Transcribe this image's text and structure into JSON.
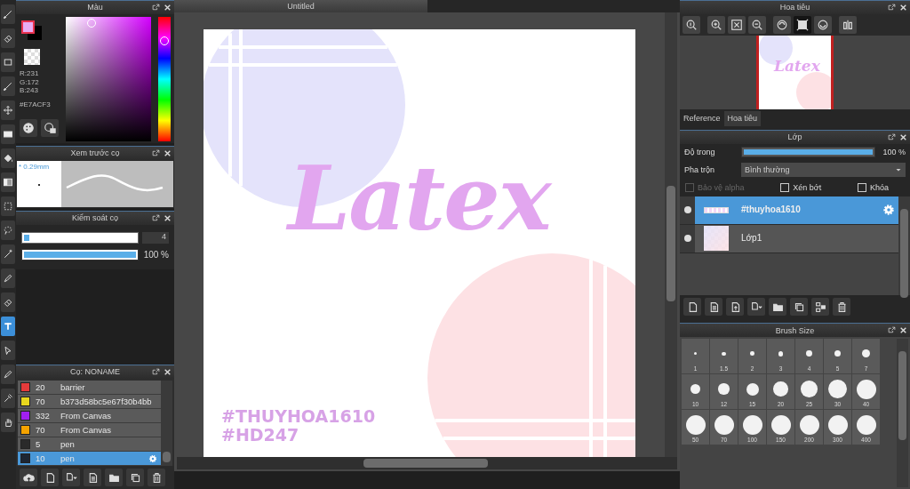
{
  "tools": [
    {
      "selected": false
    },
    {
      "selected": false
    },
    {
      "selected": false
    },
    {
      "selected": false
    },
    {
      "selected": false
    },
    {
      "selected": false
    },
    {
      "selected": false
    },
    {
      "selected": false
    },
    {
      "selected": false
    },
    {
      "selected": false
    },
    {
      "selected": false
    },
    {
      "selected": false
    },
    {
      "selected": false
    },
    {
      "selected": true
    },
    {
      "selected": false
    },
    {
      "selected": false
    },
    {
      "selected": false
    },
    {
      "selected": false
    }
  ],
  "color_panel": {
    "title": "Màu",
    "r": "R:231",
    "g": "G:172",
    "b": "B:243",
    "hex": "#E7ACF3"
  },
  "brush_preview": {
    "title": "Xem trước cọ",
    "size": "* 0.29mm"
  },
  "brush_control": {
    "title": "Kiểm soát cọ",
    "sliders": [
      {
        "kind": "boxed",
        "level": 0.05,
        "reading": "4"
      },
      {
        "kind": "plain",
        "level": 1,
        "reading": "100 %"
      }
    ]
  },
  "brush_list": {
    "title": "Cọ: NONAME",
    "brushes": [
      {
        "color": "#e53b3b",
        "size": "20",
        "name": "barrier",
        "selected": false
      },
      {
        "color": "#e8d71e",
        "size": "70",
        "name": "b373d58bc5e67f30b4bb",
        "selected": false
      },
      {
        "color": "#a11ff0",
        "size": "332",
        "name": "From Canvas",
        "selected": false
      },
      {
        "color": "#f5a300",
        "size": "70",
        "name": "From Canvas",
        "selected": false
      },
      {
        "color": "#2a2a2a",
        "size": "5",
        "name": "pen",
        "selected": false
      },
      {
        "color": "#1d2633",
        "size": "10",
        "name": "pen",
        "selected": true
      }
    ]
  },
  "document": {
    "tab": "Untitled",
    "title": "Latex",
    "tags": [
      "#THUYHOA1610",
      "#HD247"
    ]
  },
  "navigator": {
    "title": "Hoa tiêu",
    "tools": [
      {
        "selected": false
      },
      {
        "selected": false
      },
      {
        "selected": false
      },
      {
        "selected": false
      },
      {
        "selected": false
      },
      {
        "selected": true
      },
      {
        "selected": false
      },
      {
        "selected": false
      }
    ],
    "thumbnail_text": "Latex",
    "tabs": [
      {
        "label": "Reference",
        "selected": false
      },
      {
        "label": "Hoa tiêu",
        "selected": true
      }
    ]
  },
  "layers": {
    "title": "Lớp",
    "opacity_label": "Độ trong",
    "opacity": {
      "level": 1
    },
    "opacity_reading": "100 %",
    "blend_label": "Pha trộn",
    "blend_value": "Bình thường",
    "options": [
      {
        "label": "Bảo vệ alpha",
        "checked": false,
        "disabled": true
      },
      {
        "label": "Xén bớt",
        "checked": false,
        "disabled": false
      },
      {
        "label": "Khóa",
        "checked": false,
        "disabled": false
      }
    ],
    "items": [
      {
        "kind": "text",
        "name": "#thuyhoa1610",
        "selected": true,
        "visible": true
      },
      {
        "kind": "image",
        "name": "Lớp1",
        "selected": false,
        "visible": true
      }
    ]
  },
  "brush_size": {
    "title": "Brush Size",
    "sizes": [
      {
        "label": "1"
      },
      {
        "label": "1.5"
      },
      {
        "label": "2"
      },
      {
        "label": "3"
      },
      {
        "label": "4"
      },
      {
        "label": "5"
      },
      {
        "label": "7"
      },
      {
        "label": "10"
      },
      {
        "label": "12"
      },
      {
        "label": "15"
      },
      {
        "label": "20"
      },
      {
        "label": "25"
      },
      {
        "label": "30"
      },
      {
        "label": "40"
      },
      {
        "label": "50"
      },
      {
        "label": "70"
      },
      {
        "label": "100"
      },
      {
        "label": "150"
      },
      {
        "label": "200"
      },
      {
        "label": "300"
      },
      {
        "label": "400"
      }
    ]
  }
}
